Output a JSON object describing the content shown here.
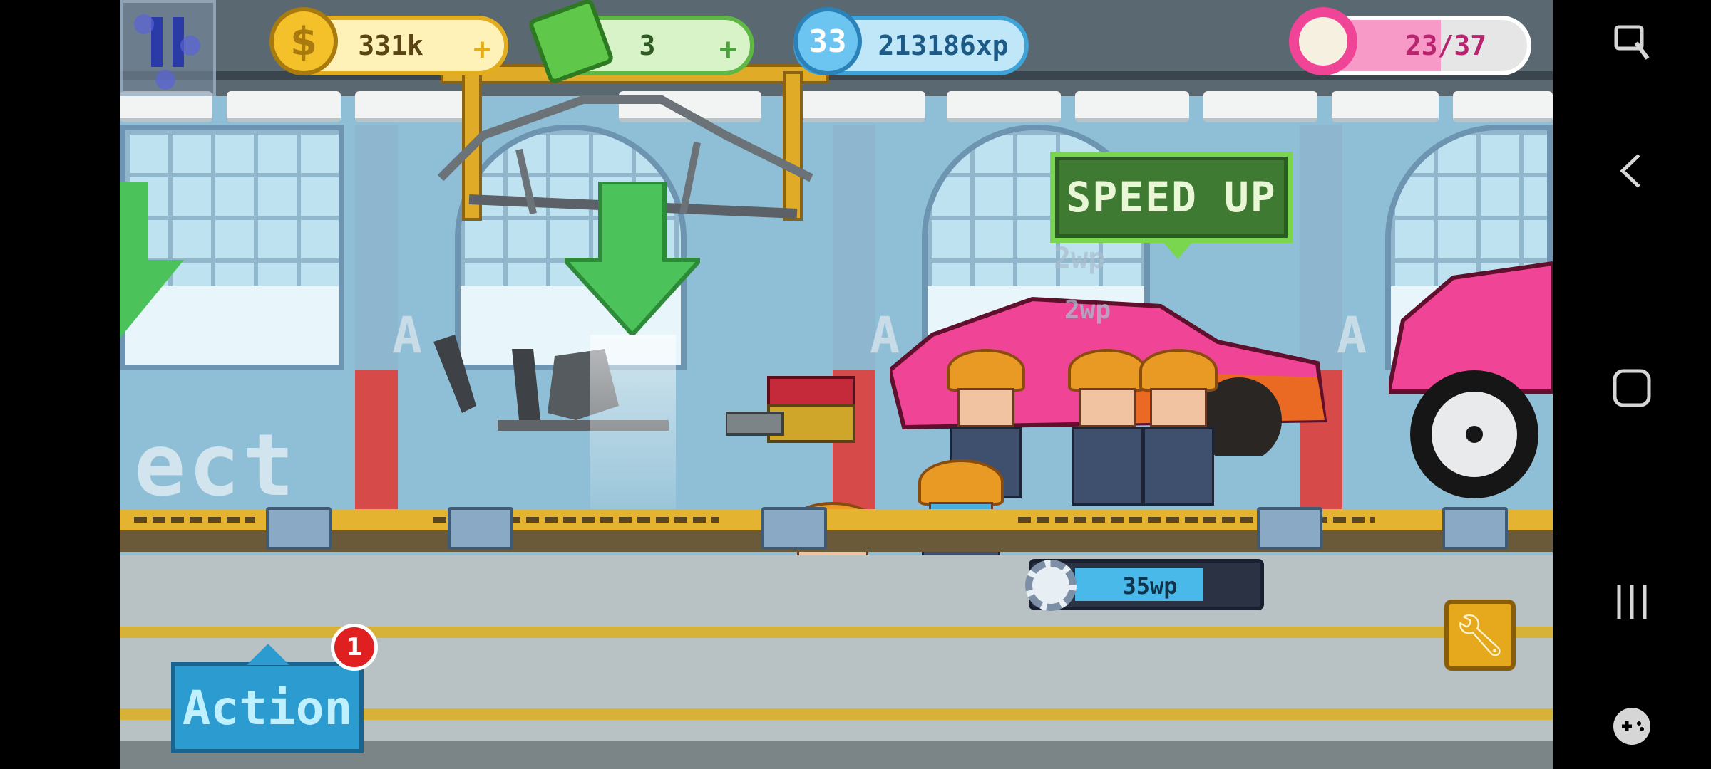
{
  "hud": {
    "coins": "331k",
    "cash": "3",
    "level": "33",
    "xp": "213186xp",
    "donuts": "23/37",
    "donut_progress": 0.62
  },
  "scene": {
    "speed_up_label": "SPEED UP",
    "floating_wp_1": "2wp",
    "floating_wp_2": "2wp",
    "background_text": "ect",
    "station_letter": "A"
  },
  "work_bar": {
    "label": "35wp",
    "progress": 0.75
  },
  "action": {
    "label": "Action",
    "badge_count": "1"
  },
  "icons": {
    "coin": "dollar-coin-icon",
    "cash": "cash-icon",
    "level": "level-badge-icon",
    "donut": "donut-icon",
    "wrench": "wrench-icon",
    "gear": "gear-icon"
  },
  "colors": {
    "coin_pill": "#e3ad1e",
    "cash_pill": "#5fb845",
    "xp_pill": "#3ea3d8",
    "donut_pill": "#f79ac8",
    "speed_up": "#3f7a32",
    "action": "#2b9bd0"
  }
}
